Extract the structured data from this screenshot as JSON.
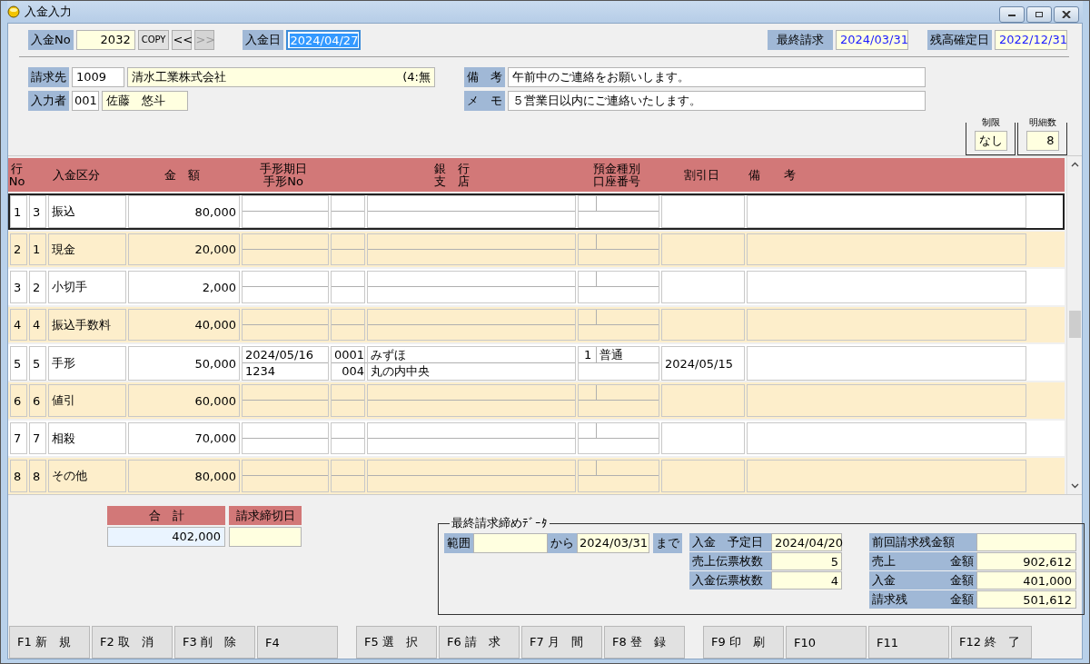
{
  "window": {
    "title": "入金入力"
  },
  "header": {
    "payment_no_label": "入金No",
    "payment_no": "2032",
    "copy_button": "COPY",
    "nav_buttons": [
      {
        "label": "<<",
        "disabled": false
      },
      {
        "label": ">>",
        "disabled": true
      }
    ],
    "payment_date_label": "入金日",
    "payment_date": "2024/04/27",
    "payment_date_text_selected": true,
    "last_billing_label": "最終請求",
    "last_billing": "2024/03/31",
    "balance_date_label": "残高確定日",
    "balance_date": "2022/12/31"
  },
  "customer": {
    "billing_label": "請求先",
    "billing_code": "1009",
    "billing_name": "清水工業株式会社",
    "billing_note": "(4:無",
    "operator_label": "入力者",
    "operator_code": "001",
    "operator_name": "佐藤　悠斗",
    "remarks_label": "備　考",
    "remarks": "午前中のご連絡をお願いします。",
    "memo_label": "メ　モ",
    "memo": "５営業日以内にご連絡いたします。",
    "limit_label": "制限",
    "limit": "なし",
    "detail_count_label": "明細数",
    "detail_count": "8"
  },
  "table": {
    "columns": [
      {
        "lines": [
          "行",
          "No"
        ]
      },
      {
        "lines": [
          "入金区分"
        ]
      },
      {
        "lines": [
          "金　額"
        ]
      },
      {
        "lines": [
          "手形期日",
          "手形No"
        ]
      },
      {
        "lines": [
          "銀　行",
          "支　店"
        ]
      },
      {
        "lines": [
          "預金種別",
          "口座番号"
        ]
      },
      {
        "lines": [
          "割引日"
        ]
      },
      {
        "lines": [
          "備　　考"
        ]
      }
    ],
    "rows": [
      {
        "no": "1",
        "code": "3",
        "kind": "振込",
        "amount": "80,000",
        "selected": true
      },
      {
        "no": "2",
        "code": "1",
        "kind": "現金",
        "amount": "20,000",
        "selected": false
      },
      {
        "no": "3",
        "code": "2",
        "kind": "小切手",
        "amount": "2,000",
        "selected": false
      },
      {
        "no": "4",
        "code": "4",
        "kind": "振込手数料",
        "amount": "40,000",
        "selected": false
      },
      {
        "no": "5",
        "code": "5",
        "kind": "手形",
        "amount": "50,000",
        "bill_due_date": "2024/05/16",
        "bill_no": "1234",
        "bank_code": "0001",
        "bank_name": "みずほ",
        "branch_code": "004",
        "branch_name": "丸の内中央",
        "account_type_code": "1",
        "account_type": "普通",
        "discount_date": "2024/05/15",
        "selected": false
      },
      {
        "no": "6",
        "code": "6",
        "kind": "値引",
        "amount": "60,000",
        "selected": false
      },
      {
        "no": "7",
        "code": "7",
        "kind": "相殺",
        "amount": "70,000",
        "selected": false
      },
      {
        "no": "8",
        "code": "8",
        "kind": "その他",
        "amount": "80,000",
        "selected": false
      }
    ]
  },
  "totals": {
    "total_label": "合　計",
    "total": "402,000",
    "closing_date_label": "請求締切日"
  },
  "last_billing_data": {
    "title": "最終請求締めﾃﾞｰﾀ",
    "range_label": "範囲",
    "from_label": "から",
    "to_date": "2024/03/31",
    "to_label": "まで",
    "left_items": [
      {
        "label": "入金　予定日",
        "value": "2024/04/20"
      },
      {
        "label": "売上伝票枚数",
        "value": "5"
      },
      {
        "label": "入金伝票枚数",
        "value": "4"
      }
    ],
    "right_items": [
      {
        "label": "前回請求残金額",
        "value": ""
      },
      {
        "label": "売上",
        "label_2": "金額",
        "value": "902,612"
      },
      {
        "label": "入金",
        "label_2": "金額",
        "value": "401,000"
      },
      {
        "label": "請求残",
        "label_2": "金額",
        "value": "501,612"
      }
    ]
  },
  "function_keys": [
    "F1 新　規",
    "F2 取　消",
    "F3 削　除",
    "F4",
    "F5 選　択",
    "F6 請　求",
    "F7 月　間",
    "F8 登　録",
    "F9 印　刷",
    "F10",
    "F11",
    "F12 終　了"
  ]
}
